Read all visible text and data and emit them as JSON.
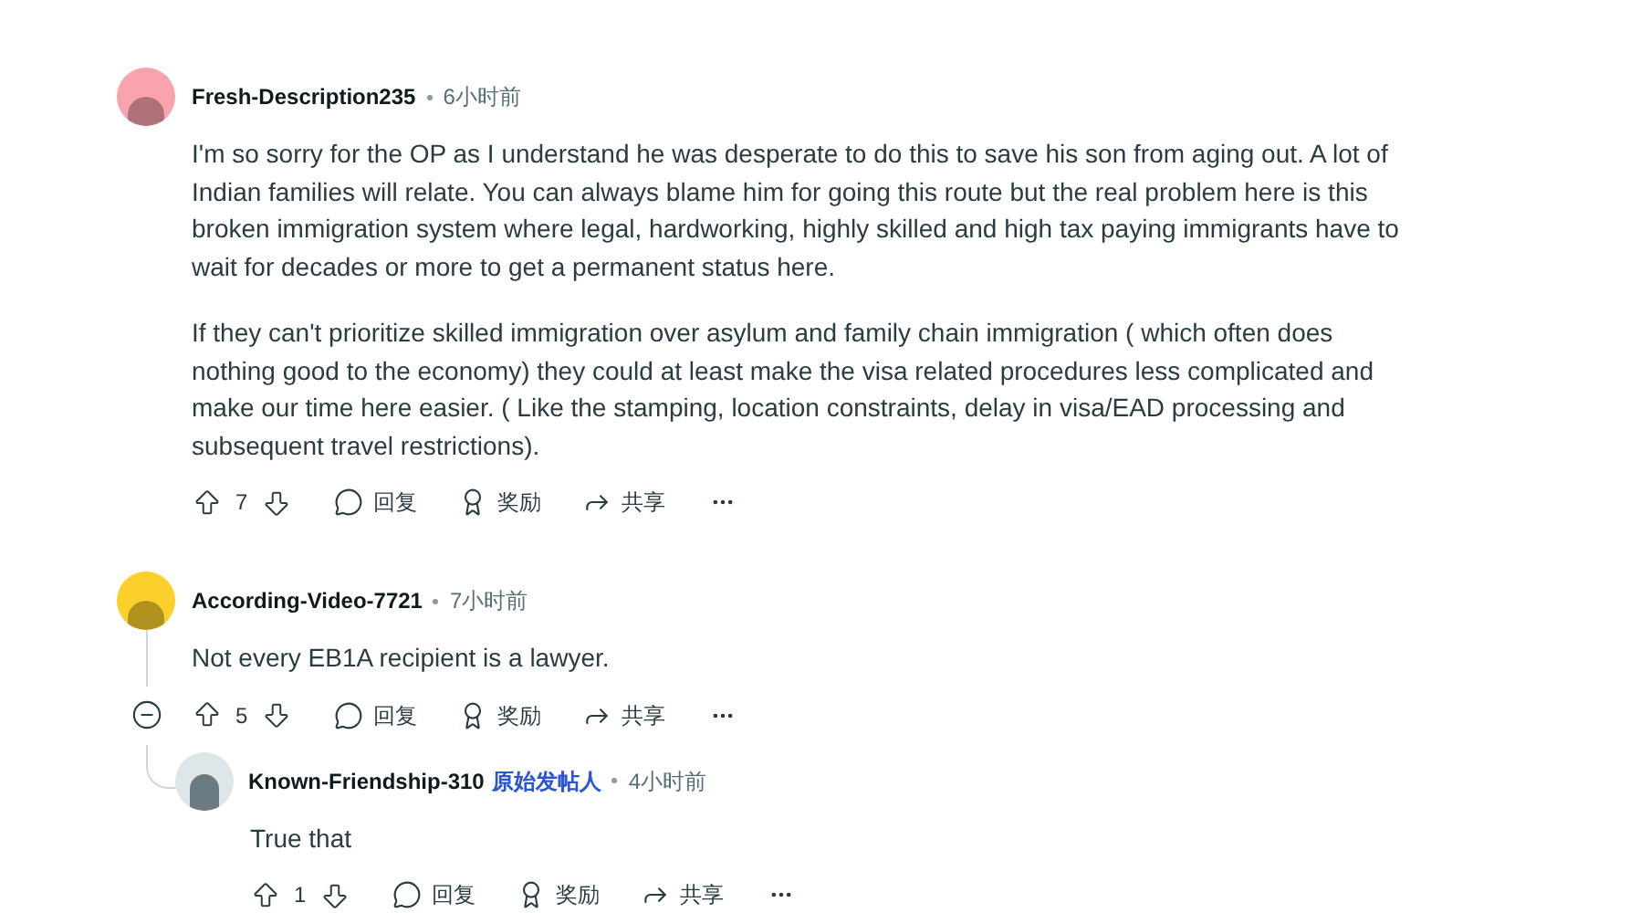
{
  "comments": [
    {
      "author": "Fresh-Description235",
      "time": "6小时前",
      "color": "#f9a3ae",
      "paragraphs": [
        "I'm so sorry for the OP as I understand he was desperate to do this to save his son from aging out. A lot of Indian families will relate. You can always blame him for going this route but the real problem here is this broken immigration system where legal, hardworking, highly skilled and high tax paying immigrants have to wait for decades or more to get a permanent status here.",
        "If they can't prioritize skilled immigration over asylum and family chain immigration ( which often does nothing good to the economy) they could at least make the visa related procedures less complicated and make our time here easier. ( Like the stamping, location constraints, delay in visa/EAD processing  and subsequent travel restrictions)."
      ],
      "votes": "7",
      "actions": [
        "回复",
        "奖励",
        "共享"
      ]
    },
    {
      "author": "According-Video-7721",
      "time": "7小时前",
      "color": "#fcd02c",
      "expanded": true,
      "paragraphs": [
        "Not every EB1A recipient is a lawyer."
      ],
      "votes": "5",
      "actions": [
        "回复",
        "奖励",
        "共享"
      ],
      "replies": [
        {
          "author": "Known-Friendship-310",
          "op_badge": "原始发帖人",
          "time": "4小时前",
          "paragraphs": [
            "True that"
          ],
          "votes": "1",
          "actions": [
            "回复",
            "奖励",
            "共享"
          ]
        }
      ]
    }
  ]
}
